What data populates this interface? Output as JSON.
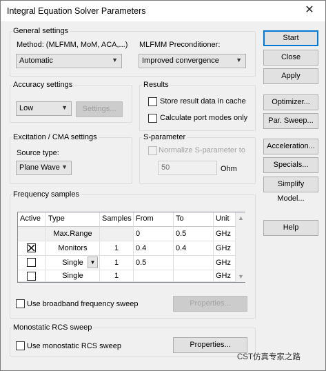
{
  "window": {
    "title": "Integral Equation Solver Parameters",
    "close_glyph": "✕"
  },
  "general": {
    "label": "General settings",
    "method_label": "Method: (MLFMM, MoM, ACA,...)",
    "method_value": "Automatic",
    "precond_label": "MLFMM Preconditioner:",
    "precond_value": "Improved convergence"
  },
  "accuracy": {
    "label": "Accuracy settings",
    "value": "Low",
    "settings_button": "Settings..."
  },
  "results": {
    "label": "Results",
    "store_cache": "Store result data in cache",
    "port_modes": "Calculate port modes only"
  },
  "excitation": {
    "label": "Excitation / CMA settings",
    "source_label": "Source type:",
    "source_value": "Plane Wave"
  },
  "sparam": {
    "label": "S-parameter",
    "normalize": "Normalize S-parameter to",
    "value": "50",
    "unit": "Ohm"
  },
  "frequency": {
    "label": "Frequency samples",
    "headers": [
      "Active",
      "Type",
      "Samples",
      "From",
      "To",
      "Unit"
    ],
    "rows": [
      {
        "type": "Max.Range",
        "samples": "",
        "from": "0",
        "to": "0.5",
        "unit": "GHz"
      },
      {
        "type": "Monitors",
        "samples": "1",
        "from": "0.4",
        "to": "0.4",
        "unit": "GHz",
        "checked": true
      },
      {
        "type": "Single",
        "samples": "1",
        "from": "0.5",
        "to": "",
        "unit": "GHz"
      },
      {
        "type": "Single",
        "samples": "1",
        "from": "",
        "to": "",
        "unit": "GHz"
      }
    ],
    "broadband": "Use broadband frequency sweep",
    "properties": "Properties..."
  },
  "rcs": {
    "label": "Monostatic RCS sweep",
    "use": "Use monostatic RCS sweep",
    "properties": "Properties..."
  },
  "buttons": {
    "start": "Start",
    "close": "Close",
    "apply": "Apply",
    "optimizer": "Optimizer...",
    "par_sweep": "Par. Sweep...",
    "acceleration": "Acceleration...",
    "specials": "Specials...",
    "simplify": "Simplify Model...",
    "help": "Help"
  },
  "watermark": "CST仿真专家之路",
  "colors": {
    "default_button_border": "#0078d7",
    "window_bg": "#f0f0f0"
  }
}
